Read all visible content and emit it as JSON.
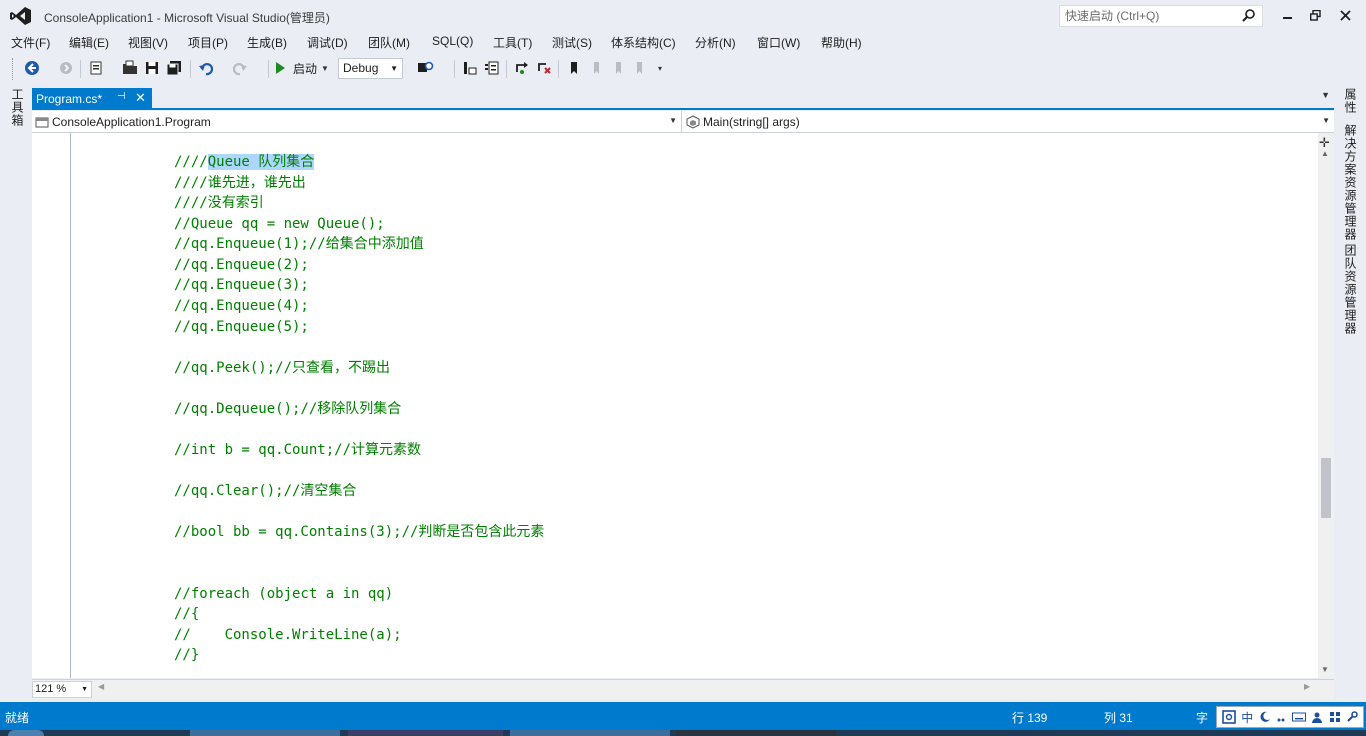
{
  "window": {
    "title": "ConsoleApplication1 - Microsoft Visual Studio(管理员)",
    "quick_launch_placeholder": "快速启动 (Ctrl+Q)"
  },
  "menu": [
    "文件(F)",
    "编辑(E)",
    "视图(V)",
    "项目(P)",
    "生成(B)",
    "调试(D)",
    "团队(M)",
    "SQL(Q)",
    "工具(T)",
    "测试(S)",
    "体系结构(C)",
    "分析(N)",
    "窗口(W)",
    "帮助(H)"
  ],
  "toolbar": {
    "start_label": "启动",
    "configuration": "Debug"
  },
  "left_panel": {
    "toolbox_label": "工具箱"
  },
  "right_panel": {
    "properties": "属性",
    "solution_explorer": "解决方案资源管理器",
    "team_explorer": "团队资源管理器"
  },
  "tab": {
    "label": "Program.cs*"
  },
  "navbar": {
    "class_scope": "ConsoleApplication1.Program",
    "member_scope": "Main(string[] args)"
  },
  "code": {
    "line1_prefix": "////",
    "line1_selected": "Queue 队列集合",
    "lines": [
      "////谁先进，谁先出",
      "////没有索引",
      "//Queue qq = new Queue();",
      "//qq.Enqueue(1);//给集合中添加值",
      "//qq.Enqueue(2);",
      "//qq.Enqueue(3);",
      "//qq.Enqueue(4);",
      "//qq.Enqueue(5);",
      "",
      "//qq.Peek();//只查看，不踢出",
      "",
      "//qq.Dequeue();//移除队列集合",
      "",
      "//int b = qq.Count;//计算元素数",
      "",
      "//qq.Clear();//清空集合",
      "",
      "//bool bb = qq.Contains(3);//判断是否包含此元素",
      "",
      "",
      "//foreach (object a in qq)",
      "//{",
      "//    Console.WriteLine(a);",
      "//}"
    ]
  },
  "editor": {
    "zoom": "121 %"
  },
  "status": {
    "ready": "就绪",
    "row": "行 139",
    "col": "列 31",
    "char": "字",
    "ime_mode": "中"
  },
  "colors": {
    "accent": "#007acc",
    "comment": "#008000",
    "selection": "#add6ff"
  }
}
